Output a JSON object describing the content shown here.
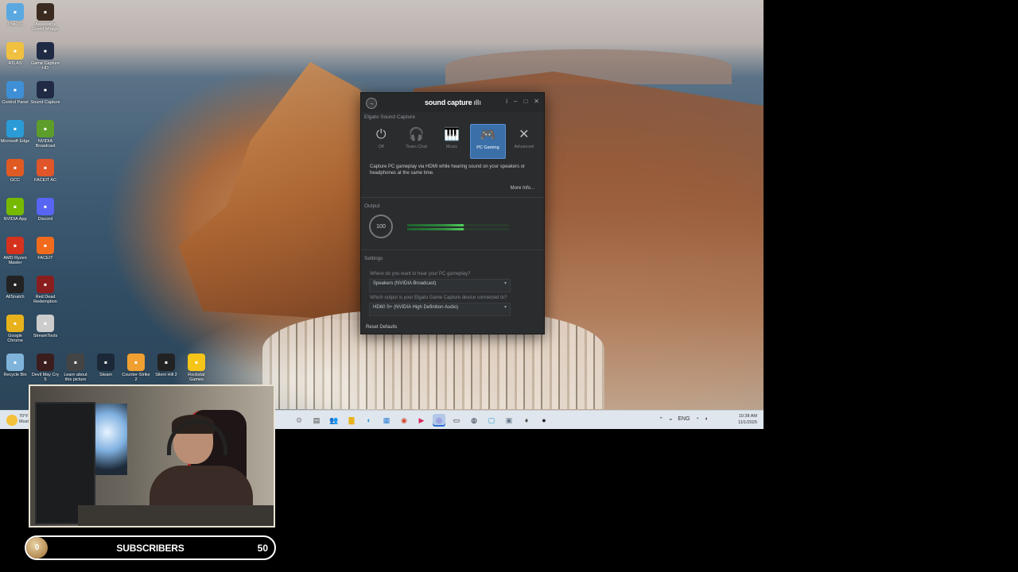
{
  "desktop_icons": [
    {
      "label": "This PC",
      "icon": "monitor-icon",
      "color": "#5aa8e0"
    },
    {
      "label": "Assassin's Creed Mirage",
      "icon": "game-icon",
      "color": "#3b2a20"
    },
    {
      "label": "ATLAS",
      "icon": "folder-icon",
      "color": "#f0c040"
    },
    {
      "label": "Game Capture HD",
      "icon": "play-icon",
      "color": "#1f2a44"
    },
    {
      "label": "Control Panel",
      "icon": "control-panel-icon",
      "color": "#3f8fd6"
    },
    {
      "label": "Sound Capture",
      "icon": "sound-capture-icon",
      "color": "#202a44"
    },
    {
      "label": "Microsoft Edge",
      "icon": "edge-icon",
      "color": "#2a9bd6"
    },
    {
      "label": "NVIDIA Broadcast",
      "icon": "nvidia-broadcast-icon",
      "color": "#5d9e2a"
    },
    {
      "label": "GCC",
      "icon": "gcc-icon",
      "color": "#e05a24"
    },
    {
      "label": "FACEIT AC",
      "icon": "faceit-ac-icon",
      "color": "#e0552a"
    },
    {
      "label": "NVIDIA App",
      "icon": "nvidia-icon",
      "color": "#76b900"
    },
    {
      "label": "Discord",
      "icon": "discord-icon",
      "color": "#5865f2"
    },
    {
      "label": "AMD Ryzen Master",
      "icon": "amd-icon",
      "color": "#d5321e"
    },
    {
      "label": "FACEIT",
      "icon": "faceit-icon",
      "color": "#f26b1d"
    },
    {
      "label": "AllSnatch",
      "icon": "allsnatch-icon",
      "color": "#222"
    },
    {
      "label": "Red Dead Redemption",
      "icon": "rdr-icon",
      "color": "#8a1e1e"
    },
    {
      "label": "Google Chrome",
      "icon": "chrome-icon",
      "color": "#e8b21c"
    },
    {
      "label": "StreamTools",
      "icon": "streamtools-icon",
      "color": "#ccc"
    },
    {
      "label": "Recycle Bin",
      "icon": "recycle-bin-icon",
      "color": "#7fb3da"
    },
    {
      "label": "Devil May Cry 5",
      "icon": "dmc-icon",
      "color": "#3b1d1d"
    },
    {
      "label": "Learn about this picture",
      "icon": "camera-icon",
      "color": "#444"
    },
    {
      "label": "Steam",
      "icon": "steam-icon",
      "color": "#1b2838"
    },
    {
      "label": "Counter-Strike 2",
      "icon": "cs2-icon",
      "color": "#f0a030"
    },
    {
      "label": "Silent Hill 2",
      "icon": "silent-hill-icon",
      "color": "#222"
    },
    {
      "label": "Rockstar Games",
      "icon": "rockstar-icon",
      "color": "#f5c518"
    }
  ],
  "taskbar": {
    "apps": [
      {
        "name": "settings-icon",
        "glyph": "⚙",
        "color": "#888"
      },
      {
        "name": "file-icon",
        "glyph": "▤",
        "color": "#444"
      },
      {
        "name": "people-icon",
        "glyph": "👥",
        "color": "#5b6fd6"
      },
      {
        "name": "folder-icon",
        "glyph": "▇",
        "color": "#e8b21c"
      },
      {
        "name": "edge-icon",
        "glyph": "◐",
        "color": "#2a9bd6"
      },
      {
        "name": "store-icon",
        "glyph": "▦",
        "color": "#2b7fd6"
      },
      {
        "name": "chrome-icon",
        "glyph": "◉",
        "color": "#d6452b"
      },
      {
        "name": "media-icon",
        "glyph": "▶",
        "color": "#d6245a"
      },
      {
        "name": "sound-capture-icon",
        "glyph": "◎",
        "color": "#6b4bd6"
      },
      {
        "name": "terminal-icon",
        "glyph": "▭",
        "color": "#222"
      },
      {
        "name": "steam-icon",
        "glyph": "◍",
        "color": "#1b2838"
      },
      {
        "name": "monitor-icon",
        "glyph": "▢",
        "color": "#2a9bd6"
      },
      {
        "name": "display-icon",
        "glyph": "▣",
        "color": "#6a7a8a"
      },
      {
        "name": "pin-icon",
        "glyph": "♦",
        "color": "#555"
      },
      {
        "name": "app-icon",
        "glyph": "●",
        "color": "#222"
      }
    ],
    "active_index": 8,
    "tray_language": "ENG",
    "clock_time": "10:38 AM",
    "clock_date": "11/1/2025",
    "weather_temp": "70°F",
    "weather_text": "Mostly..."
  },
  "app": {
    "brand": "sound capture",
    "section_title": "Elgato Sound Capture",
    "modes": [
      {
        "label": "Off",
        "icon": "power-icon",
        "glyph": "⏻"
      },
      {
        "label": "Team Chat",
        "icon": "headset-icon",
        "glyph": "🎧"
      },
      {
        "label": "Music",
        "icon": "piano-icon",
        "glyph": "🎹"
      },
      {
        "label": "PC Gaming",
        "icon": "gamepad-icon",
        "glyph": "🎮"
      },
      {
        "label": "Advanced",
        "icon": "tools-icon",
        "glyph": "✕"
      }
    ],
    "active_mode": 3,
    "description": "Capture PC gameplay via HDMI while hearing sound on your speakers or headphones at the same time.",
    "more_info": "More Info...",
    "output_title": "Output",
    "output_level": "100",
    "settings_title": "Settings",
    "question_1": "Where do you want to hear your PC gameplay?",
    "select_1": "Speakers (NVIDIA Broadcast)",
    "question_2": "Which output is your Elgato Game Capture device connected to?",
    "select_2": "HD60 S+ (NVIDIA High Definition Audio)",
    "reset": "Reset Defaults"
  },
  "subscribers": {
    "current": "0",
    "label": "SUBSCRIBERS",
    "goal": "50",
    "progress_fraction": 0
  }
}
